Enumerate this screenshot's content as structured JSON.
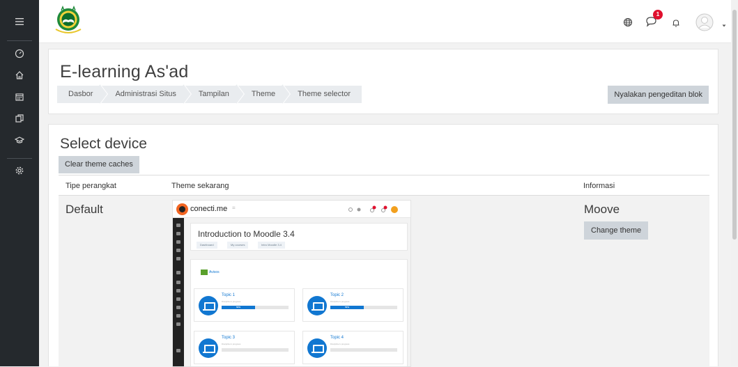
{
  "sidebar": {
    "items": [
      {
        "icon": "menu-icon"
      },
      {
        "icon": "dashboard-gauge-icon"
      },
      {
        "icon": "home-icon"
      },
      {
        "icon": "calendar-icon"
      },
      {
        "icon": "files-icon"
      },
      {
        "icon": "graduation-cap-icon"
      },
      {
        "icon": "gear-icon"
      }
    ]
  },
  "navbar": {
    "logo_icon": "institution-logo-icon",
    "language_icon": "globe-icon",
    "messages_icon": "message-bubble-icon",
    "notification_badge": "1",
    "notifications_icon": "bell-icon",
    "user_icon": "user-avatar-icon",
    "menu_icon": "caret-down-icon"
  },
  "header": {
    "site_title": "E-learning As'ad",
    "breadcrumb": [
      "Dasbor",
      "Administrasi Situs",
      "Tampilan",
      "Theme",
      "Theme selector"
    ],
    "edit_button": "Nyalakan pengeditan blok"
  },
  "main": {
    "heading": "Select device",
    "clear_button": "Clear theme caches",
    "columns": [
      "Tipe perangkat",
      "Theme sekarang",
      "Informasi"
    ],
    "rows": [
      {
        "device": "Default",
        "theme": "Moove",
        "change_button": "Change theme",
        "preview": {
          "brand": "conecti.me",
          "course_title": "Introduction to Moodle 3.4",
          "breadcrumb": [
            "Dashboard",
            "My courses",
            "Intro Moodle 3.4"
          ],
          "activity": "Avisos",
          "topics": [
            {
              "name": "Topic 1",
              "subtitle": "Discipline's progress",
              "progress": 0.5,
              "label": "50%"
            },
            {
              "name": "Topic 2",
              "subtitle": "Discipline's progress",
              "progress": 0.5,
              "label": "50%"
            },
            {
              "name": "Topic 3",
              "subtitle": "Discipline's progress",
              "progress": 0,
              "label": ""
            },
            {
              "name": "Topic 4",
              "subtitle": "Discipline's progress",
              "progress": 0,
              "label": ""
            }
          ]
        }
      }
    ]
  },
  "colors": {
    "sidebar_bg": "#25292d",
    "button_gray": "#ced4da",
    "notification_red": "#e0102e",
    "preview_accent": "#1177d1",
    "preview_logo": "#f26522"
  }
}
